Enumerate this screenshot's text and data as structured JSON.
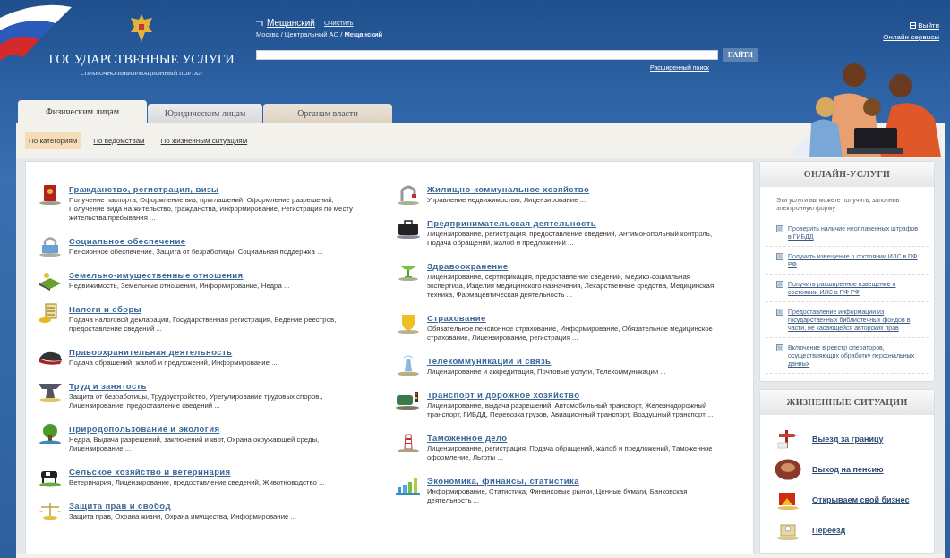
{
  "header": {
    "portal_title": "ГОСУДАРСТВЕННЫЕ УСЛУГИ",
    "portal_subtitle": "СПРАВОЧНО-ИНФОРМАЦИОННЫЙ ПОРТАЛ",
    "location": {
      "district": "Мещанский",
      "clear_link": "Очистить",
      "breadcrumb": "Москва / Центральный АО / **Мещанский**"
    },
    "search": {
      "button": "НАЙТИ",
      "advanced_link": "Расширенный поиск"
    },
    "logout_link": "Выйти",
    "online_services_link": "Онлайн-сервисы"
  },
  "tabs": [
    {
      "label": "Физическим лицам",
      "selected": true
    },
    {
      "label": "Юридическим лицам",
      "selected": false
    },
    {
      "label": "Органам власти",
      "selected": false
    }
  ],
  "subnav": [
    {
      "label": "По категориям",
      "selected": true
    },
    {
      "label": "По ведомствам",
      "selected": false
    },
    {
      "label": "По жизненным ситуациям",
      "selected": false
    }
  ],
  "categories": {
    "column_1": [
      {
        "title": "Гражданство, регистрация, визы",
        "description": "Получение паспорта, Оформление виз, приглашений, Оформление разрешений, Получение вида на жительство, гражданства, Информирование, Регистрация по месту жительства/пребывания ..."
      },
      {
        "title": "Социальное обеспечение",
        "description": "Пенсионное обеспечение, Защита от безработицы, Социальная поддержка ..."
      },
      {
        "title": "Земельно-имущественные отношения",
        "description": "Недвижимость, Земельные отношения, Информирование, Недра ..."
      },
      {
        "title": "Налоги и сборы",
        "description": "Подача налоговой декларации, Государственная регистрация, Ведение реестров, предоставление сведений ..."
      },
      {
        "title": "Правоохранительная деятельность",
        "description": "Подача обращений, жалоб и предложений, Информирование ..."
      },
      {
        "title": "Труд и занятость",
        "description": "Защита от безработицы, Трудоустройство, Урегулирование трудовых споров., Лицензирование, предоставление сведений ..."
      },
      {
        "title": "Природопользование и экология",
        "description": "Недра, Выдача разрешений, заключений и квот, Охрана окружающей среды, Лицензирование ..."
      },
      {
        "title": "Сельское хозяйство и ветеринария",
        "description": "Ветеринария, Лицензирование, предоставление сведений, Животноводство ..."
      },
      {
        "title": "Защита прав и свобод",
        "description": "Защита прав, Охрана жизни, Охрана имущества, Информирование ..."
      }
    ],
    "column_2": [
      {
        "title": "Жилищно-коммунальное хозяйство",
        "description": "Управление недвижимостью, Лицензирование ..."
      },
      {
        "title": "Предпринимательская деятельность",
        "description": "Лицензирование, регистрация, предоставление сведений, Антимонопольный контроль, Подача обращений, жалоб и предложений ..."
      },
      {
        "title": "Здравоохранение",
        "description": "Лицензирование, сертификация, предоставление сведений, Медико-социальная экспертиза, Изделия медицинского назначения, Лекарственные средства, Медицинская техника, Фармацевтическая деятельность ..."
      },
      {
        "title": "Страхование",
        "description": "Обязательное пенсионное страхование, Информирование, Обязательное медицинское страхование, Лицензирование, регистрация ..."
      },
      {
        "title": "Телекоммуникации и связь",
        "description": "Лицензирование и аккредитация, Почтовые услуги, Телекоммуникации ..."
      },
      {
        "title": "Транспорт и дорожное хозяйство",
        "description": "Лицензирование, выдача разрешений, Автомобильный транспорт, Железнодорожный транспорт, ГИБДД, Перевозка грузов, Авиационный транспорт, Воздушный транспорт ..."
      },
      {
        "title": "Таможенное дело",
        "description": "Лицензирование, регистрация, Подача обращений, жалоб и предложений, Таможенное оформление, Льготы ..."
      },
      {
        "title": "Экономика, финансы, статистика",
        "description": "Информирование, Статистика, Финансовые рынки, Ценные бумаги, Банковская деятельность ..."
      }
    ]
  },
  "online_services": {
    "title": "ОНЛАЙН-УСЛУГИ",
    "intro": "Эти услуги вы можете получить, заполнив электронную форму",
    "links": [
      "Проверить наличие неоплаченных штрафов в ГИБДД",
      "Получить извещение о состоянии ИЛС в ПФ РФ",
      "Получить расширенное извещение о состоянии ИЛС в ПФ РФ",
      "Предоставление информации из государственных библиотечных фондов в части, не касающейся авторских прав",
      "Включение в реестр операторов, осуществляющих обработку персональных данных"
    ]
  },
  "life_situations": {
    "title": "ЖИЗНЕННЫЕ СИТУАЦИИ",
    "links": [
      "Выезд за границу",
      "Выход на пенсию",
      "Открываем свой бизнес",
      "Переезд"
    ]
  }
}
